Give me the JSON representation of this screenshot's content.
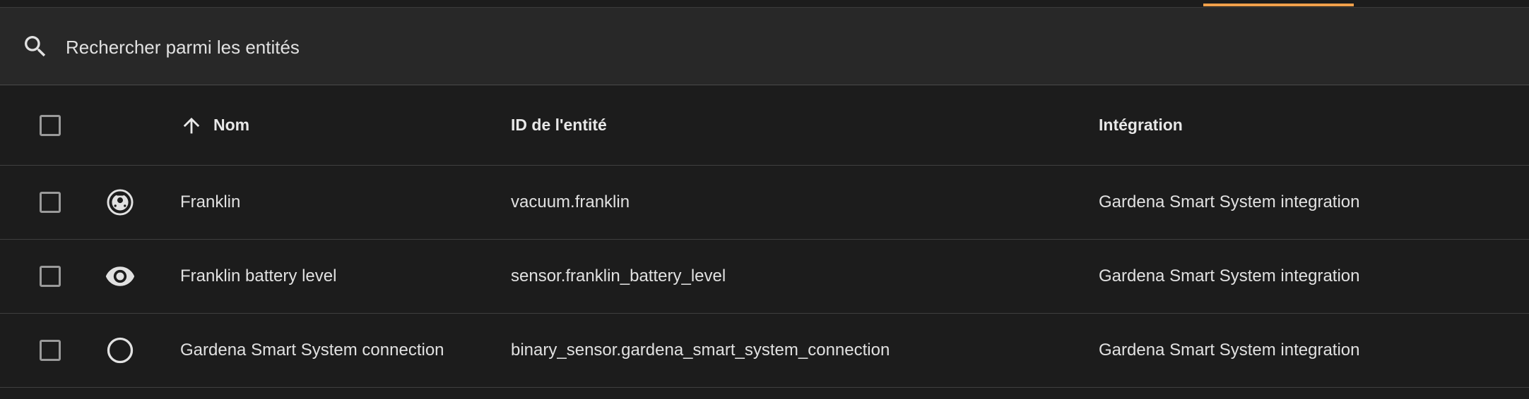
{
  "search": {
    "placeholder": "Rechercher parmi les entités"
  },
  "table": {
    "columns": {
      "name": "Nom",
      "entity_id": "ID de l'entité",
      "integration": "Intégration"
    },
    "sort": {
      "column": "name",
      "direction": "ascending"
    },
    "rows": [
      {
        "icon": "robot-vacuum-icon",
        "name": "Franklin",
        "entity_id": "vacuum.franklin",
        "integration": "Gardena Smart System integration"
      },
      {
        "icon": "eye-icon",
        "name": "Franklin battery level",
        "entity_id": "sensor.franklin_battery_level",
        "integration": "Gardena Smart System integration"
      },
      {
        "icon": "circle-outline-icon",
        "name": "Gardena Smart System connection",
        "entity_id": "binary_sensor.gardena_smart_system_connection",
        "integration": "Gardena Smart System integration"
      }
    ]
  },
  "colors": {
    "background": "#1c1c1c",
    "search_background": "#282828",
    "accent": "#f0a04b",
    "text": "#e1e1e1",
    "divider": "#3f3f3f"
  }
}
